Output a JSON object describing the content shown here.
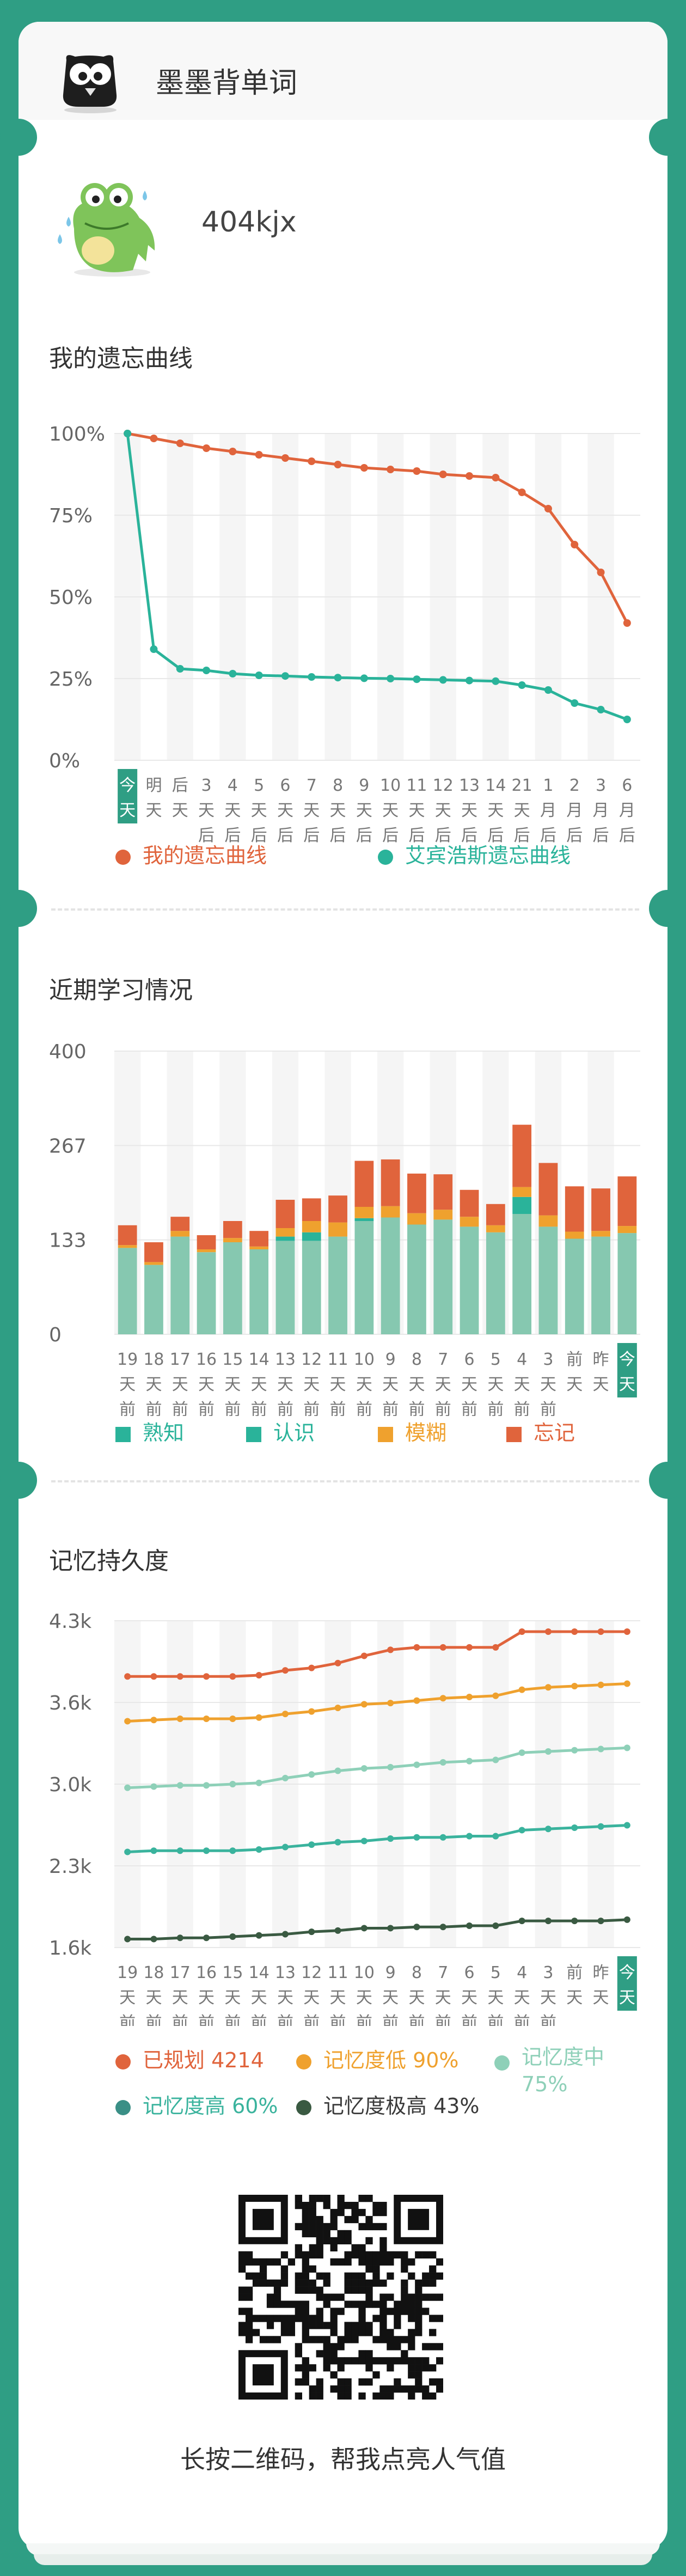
{
  "header": {
    "app_name": "墨墨背单词"
  },
  "user": {
    "name": "404kjx"
  },
  "colors": {
    "accent": "#2f9e84",
    "forget_red": "#e0643c",
    "ebb_teal": "#2ab39a",
    "known": "#86c8b0",
    "recognize": "#2ab39a",
    "vague": "#efa12e",
    "forgot": "#e0643c",
    "plan_red": "#e0643c",
    "low_orange": "#efa12e",
    "mid_green": "#8ed0b8",
    "high_teal": "#3ab39d",
    "top_dark": "#3a5a42"
  },
  "forgetting": {
    "title": "我的遗忘曲线",
    "legend": [
      "我的遗忘曲线",
      "艾宾浩斯遗忘曲线"
    ]
  },
  "study": {
    "title": "近期学习情况",
    "legend": [
      "熟知",
      "认识",
      "模糊",
      "忘记"
    ]
  },
  "memory": {
    "title": "记忆持久度",
    "legend": [
      "已规划 4214",
      "记忆度低 90%",
      "记忆度中 75%",
      "记忆度高 60%",
      "记忆度极高 43%"
    ]
  },
  "qr": {
    "caption": "长按二维码，帮我点亮人气值"
  },
  "chart_data": [
    {
      "type": "line",
      "title": "我的遗忘曲线",
      "y_ticks": [
        "100%",
        "75%",
        "50%",
        "25%",
        "0%"
      ],
      "ylim": [
        0,
        100
      ],
      "categories": [
        "今天",
        "明天",
        "后天",
        "3天后",
        "4天后",
        "5天后",
        "6天后",
        "7天后",
        "8天后",
        "9天后",
        "10天后",
        "11天后",
        "12天后",
        "13天后",
        "14天后",
        "21天后",
        "1月后",
        "2月后",
        "3月后",
        "6月后"
      ],
      "highlight_index": 0,
      "series": [
        {
          "name": "我的遗忘曲线",
          "values": [
            100,
            98.5,
            97,
            95.5,
            94.5,
            93.5,
            92.5,
            91.5,
            90.5,
            89.5,
            89,
            88.5,
            87.5,
            87,
            86.5,
            82,
            77,
            66,
            57.5,
            42
          ]
        },
        {
          "name": "艾宾浩斯遗忘曲线",
          "values": [
            100,
            34,
            28,
            27.5,
            26.5,
            26,
            25.8,
            25.5,
            25.3,
            25.1,
            25,
            24.8,
            24.6,
            24.4,
            24.2,
            23,
            21.5,
            17.5,
            15.5,
            12.5
          ]
        }
      ]
    },
    {
      "type": "bar",
      "title": "近期学习情况",
      "y_ticks": [
        "400",
        "267",
        "133",
        "0"
      ],
      "ylim": [
        0,
        400
      ],
      "categories": [
        "19天前",
        "18天前",
        "17天前",
        "16天前",
        "15天前",
        "14天前",
        "13天前",
        "12天前",
        "11天前",
        "10天前",
        "9天前",
        "8天前",
        "7天前",
        "6天前",
        "5天前",
        "4天前",
        "3天前",
        "前天",
        "昨天",
        "今天"
      ],
      "highlight_index": 19,
      "series": [
        {
          "name": "熟知",
          "values": [
            122,
            98,
            138,
            116,
            130,
            120,
            132,
            132,
            138,
            160,
            165,
            155,
            162,
            152,
            144,
            170,
            152,
            135,
            138,
            143
          ]
        },
        {
          "name": "认识",
          "values": [
            0,
            0,
            0,
            0,
            0,
            0,
            6,
            12,
            0,
            4,
            0,
            0,
            0,
            0,
            0,
            24,
            0,
            0,
            0,
            0
          ]
        },
        {
          "name": "模糊",
          "values": [
            4,
            4,
            8,
            4,
            6,
            4,
            12,
            16,
            20,
            16,
            16,
            16,
            14,
            14,
            10,
            14,
            16,
            10,
            8,
            10
          ]
        },
        {
          "name": "忘记",
          "values": [
            28,
            28,
            20,
            20,
            24,
            22,
            40,
            32,
            38,
            65,
            66,
            56,
            50,
            38,
            30,
            88,
            74,
            64,
            60,
            70
          ]
        }
      ]
    },
    {
      "type": "line",
      "title": "记忆持久度",
      "y_ticks": [
        "4.3k",
        "3.6k",
        "3.0k",
        "2.3k",
        "1.6k"
      ],
      "ylim": [
        1.6,
        4.3
      ],
      "categories": [
        "19天前",
        "18天前",
        "17天前",
        "16天前",
        "15天前",
        "14天前",
        "13天前",
        "12天前",
        "11天前",
        "10天前",
        "9天前",
        "8天前",
        "7天前",
        "6天前",
        "5天前",
        "4天前",
        "3天前",
        "前天",
        "昨天",
        "今天"
      ],
      "highlight_index": 19,
      "series": [
        {
          "name": "已规划",
          "values": [
            3.84,
            3.84,
            3.84,
            3.84,
            3.84,
            3.85,
            3.89,
            3.91,
            3.95,
            4.01,
            4.06,
            4.08,
            4.08,
            4.08,
            4.08,
            4.21,
            4.21,
            4.21,
            4.21,
            4.21
          ]
        },
        {
          "name": "记忆度低",
          "values": [
            3.47,
            3.48,
            3.49,
            3.49,
            3.49,
            3.5,
            3.53,
            3.55,
            3.58,
            3.61,
            3.62,
            3.64,
            3.66,
            3.67,
            3.68,
            3.73,
            3.75,
            3.76,
            3.77,
            3.78
          ]
        },
        {
          "name": "记忆度中",
          "values": [
            2.92,
            2.93,
            2.94,
            2.94,
            2.95,
            2.96,
            3.0,
            3.03,
            3.06,
            3.08,
            3.09,
            3.11,
            3.13,
            3.14,
            3.15,
            3.21,
            3.22,
            3.23,
            3.24,
            3.25
          ]
        },
        {
          "name": "记忆度高",
          "values": [
            2.39,
            2.4,
            2.4,
            2.4,
            2.4,
            2.41,
            2.43,
            2.45,
            2.47,
            2.48,
            2.5,
            2.51,
            2.51,
            2.52,
            2.52,
            2.57,
            2.58,
            2.59,
            2.6,
            2.61
          ]
        },
        {
          "name": "记忆度极高",
          "values": [
            1.67,
            1.67,
            1.68,
            1.68,
            1.69,
            1.7,
            1.71,
            1.73,
            1.74,
            1.76,
            1.76,
            1.77,
            1.77,
            1.78,
            1.78,
            1.82,
            1.82,
            1.82,
            1.82,
            1.83
          ]
        }
      ]
    }
  ]
}
